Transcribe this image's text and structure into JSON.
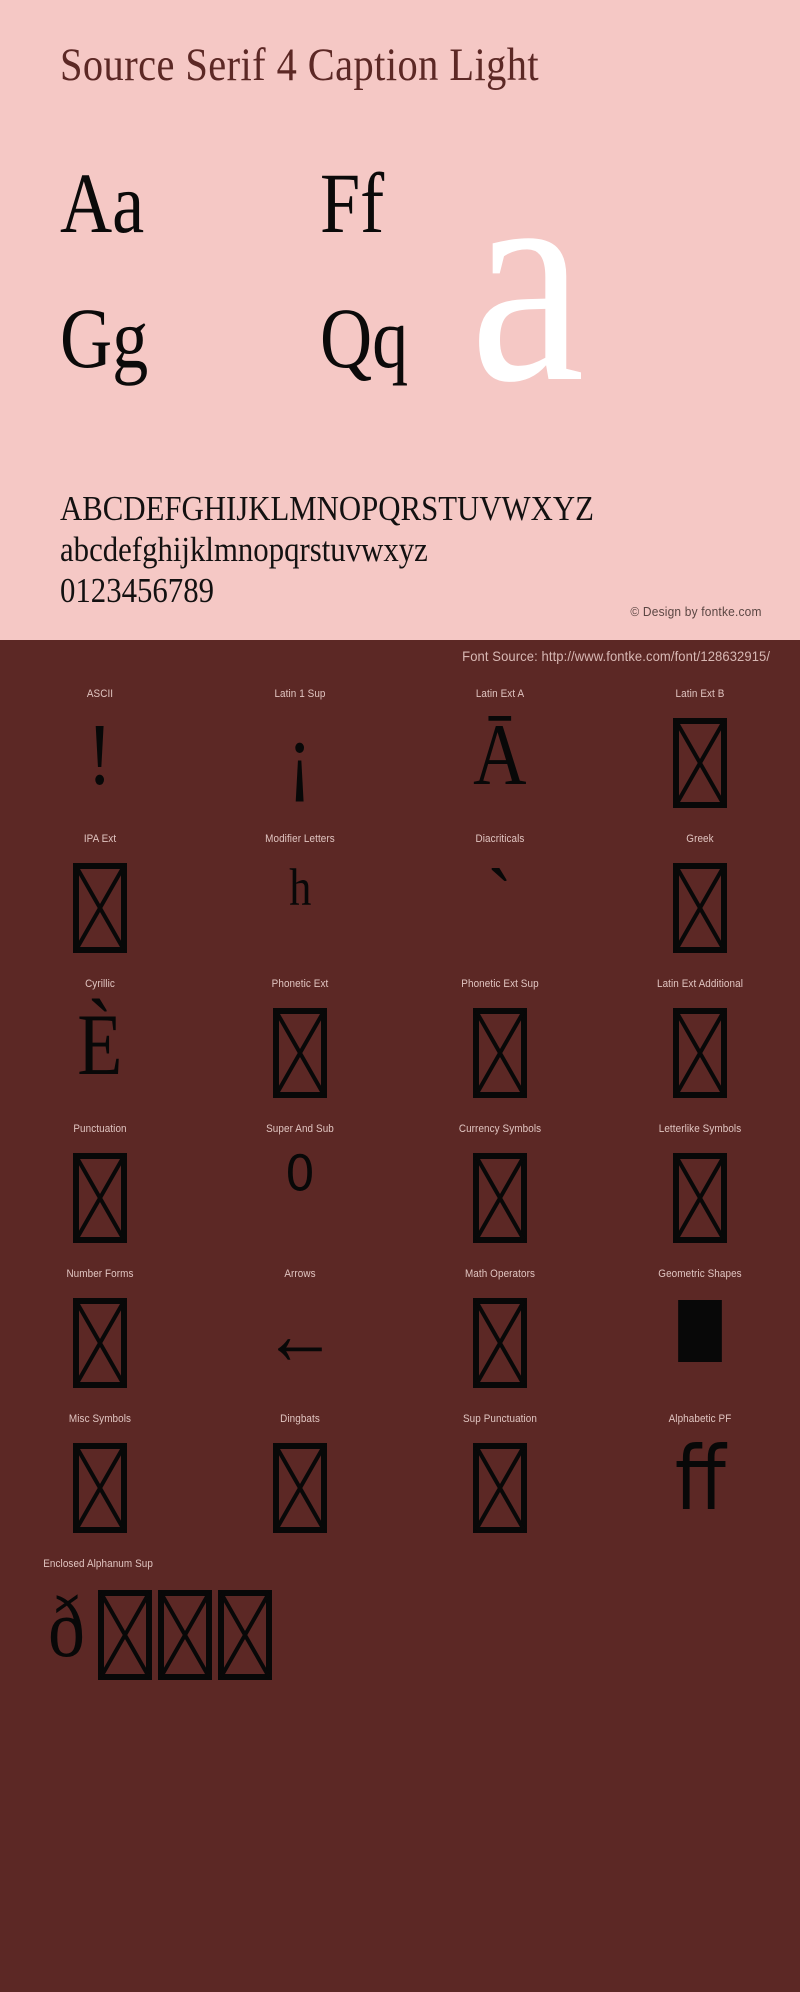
{
  "header": {
    "title": "Source Serif 4 Caption Light",
    "background_color": "#f5c8c5",
    "title_color": "#5c2825"
  },
  "specimen": {
    "waterfall": [
      {
        "pair": "Aa"
      },
      {
        "pair": "Ff"
      },
      {
        "pair": "Gg"
      },
      {
        "pair": "Qq"
      }
    ],
    "feature_glyph": "a",
    "feature_glyph_color": "#ffffff",
    "charset_lines": [
      "ABCDEFGHIJKLMNOPQRSTUVWXYZ",
      "abcdefghijklmnopqrstuvwxyz",
      "0123456789"
    ],
    "copyright": "© Design by fontke.com"
  },
  "footer_band": {
    "background_color": "#5c2825",
    "font_source": "Font Source: http://www.fontke.com/font/128632915/"
  },
  "unicode_blocks": {
    "label_color": "#e0c4c0",
    "glyph_color": "#080808",
    "rows": [
      [
        {
          "label": "ASCII",
          "glyph": "!",
          "kind": "char"
        },
        {
          "label": "Latin 1 Sup",
          "glyph": "¡",
          "kind": "char"
        },
        {
          "label": "Latin Ext A",
          "glyph": "Ā",
          "kind": "char"
        },
        {
          "label": "Latin Ext B",
          "glyph": "",
          "kind": "notdef"
        }
      ],
      [
        {
          "label": "IPA Ext",
          "glyph": "",
          "kind": "notdef"
        },
        {
          "label": "Modifier Letters",
          "glyph": "ʰ",
          "kind": "char"
        },
        {
          "label": "Diacriticals",
          "glyph": "ˋ",
          "kind": "char"
        },
        {
          "label": "Greek",
          "glyph": "",
          "kind": "notdef"
        }
      ],
      [
        {
          "label": "Cyrillic",
          "glyph": "Ѐ",
          "kind": "char"
        },
        {
          "label": "Phonetic Ext",
          "glyph": "",
          "kind": "notdef"
        },
        {
          "label": "Phonetic Ext Sup",
          "glyph": "",
          "kind": "notdef"
        },
        {
          "label": "Latin Ext Additional",
          "glyph": "",
          "kind": "notdef"
        }
      ],
      [
        {
          "label": "Punctuation",
          "glyph": "",
          "kind": "notdef"
        },
        {
          "label": "Super And Sub",
          "glyph": "⁰",
          "kind": "char"
        },
        {
          "label": "Currency Symbols",
          "glyph": "",
          "kind": "notdef"
        },
        {
          "label": "Letterlike Symbols",
          "glyph": "",
          "kind": "notdef"
        }
      ],
      [
        {
          "label": "Number Forms",
          "glyph": "",
          "kind": "notdef"
        },
        {
          "label": "Arrows",
          "glyph": "←",
          "kind": "char"
        },
        {
          "label": "Math Operators",
          "glyph": "",
          "kind": "notdef"
        },
        {
          "label": "Geometric Shapes",
          "glyph": "",
          "kind": "filled-square"
        }
      ],
      [
        {
          "label": "Misc Symbols",
          "glyph": "",
          "kind": "notdef"
        },
        {
          "label": "Dingbats",
          "glyph": "",
          "kind": "notdef"
        },
        {
          "label": "Sup Punctuation",
          "glyph": "",
          "kind": "notdef"
        },
        {
          "label": "Alphabetic PF",
          "glyph": "ﬀ",
          "kind": "char"
        }
      ]
    ],
    "last_row": {
      "label": "Enclosed Alphanum Sup",
      "glyphs": [
        {
          "glyph": "ð",
          "kind": "char"
        },
        {
          "glyph": "",
          "kind": "notdef"
        },
        {
          "glyph": "",
          "kind": "notdef"
        },
        {
          "glyph": "",
          "kind": "notdef"
        }
      ]
    }
  }
}
